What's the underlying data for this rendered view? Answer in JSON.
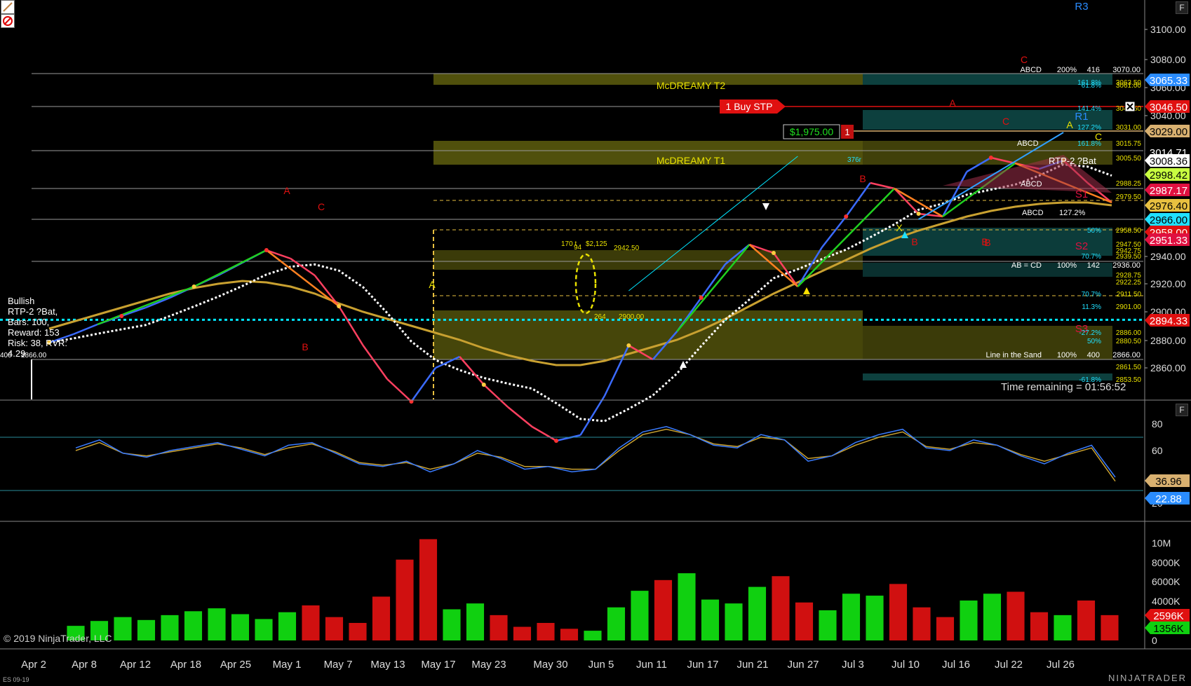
{
  "window": {
    "footer_left": "ES 09-19",
    "copyright": "© 2019 NinjaTrader, LLC",
    "brand": "NINJATRADER",
    "time_remaining": "Time remaining = 01:56:52",
    "panel_button": "F"
  },
  "colors": {
    "background": "#000000",
    "price_up": "#3b6bff",
    "price_down": "#ff4060",
    "sma_white": "#ffffff",
    "sma_gold": "#c8a030",
    "cyan_line": "#00e5ff",
    "volume_up": "#10d010",
    "volume_down": "#d01010",
    "zone_olive": "#6b6b10",
    "zone_teal": "#10504e"
  },
  "x_axis": {
    "labels": [
      "Apr 2",
      "Apr 8",
      "Apr 12",
      "Apr 18",
      "Apr 25",
      "May 1",
      "May 7",
      "May 13",
      "May 17",
      "May 23",
      "May 30",
      "Jun 5",
      "Jun 11",
      "Jun 17",
      "Jun 21",
      "Jun 27",
      "Jul 3",
      "Jul 10",
      "Jul 16",
      "Jul 22",
      "Jul 26"
    ]
  },
  "price_panel": {
    "y_ticks": [
      "3100.00",
      "3080.00",
      "3060.00",
      "3040.00",
      "2940.00",
      "2920.00",
      "2900.00",
      "2880.00",
      "2860.00"
    ],
    "tags": [
      {
        "value": "3065.33",
        "bg": "#2a8cff",
        "fg": "#ffffff"
      },
      {
        "value": "3046.50",
        "bg": "#e01010",
        "fg": "#ffffff"
      },
      {
        "value": "3029.00",
        "bg": "#d8b070",
        "fg": "#000000"
      },
      {
        "value": "3014.71",
        "bg": "#000000",
        "fg": "#ffffff"
      },
      {
        "value": "3008.36",
        "bg": "#ffffff",
        "fg": "#000000"
      },
      {
        "value": "2998.42",
        "bg": "#c8ff40",
        "fg": "#000000"
      },
      {
        "value": "2987.17",
        "bg": "#e01040",
        "fg": "#ffffff"
      },
      {
        "value": "2976.40",
        "bg": "#e8c040",
        "fg": "#000000"
      },
      {
        "value": "2966.00",
        "bg": "#20e0ff",
        "fg": "#000000"
      },
      {
        "value": "2958.00",
        "bg": "#e01010",
        "fg": "#ffffff"
      },
      {
        "value": "2951.33",
        "bg": "#e01040",
        "fg": "#ffffff"
      },
      {
        "value": "2894.33",
        "bg": "#e01010",
        "fg": "#ffffff"
      }
    ],
    "pivots": [
      "R3",
      "R1",
      "S1",
      "S2",
      "S3"
    ],
    "zone_labels": {
      "t2": "McDREAMY T2",
      "t1": "McDREAMY T1"
    },
    "order_label": "1 Buy STP",
    "pnl_label": "$1,975.00",
    "pnl_qty": "1",
    "pattern_box": [
      "Bullish",
      "RTP-2 ?Bat,",
      "Bars: 100,",
      "Reward: 153",
      "Risk: 38, RVR:",
      "4.29"
    ],
    "rtp_tag": "RTP-2 ?Bat",
    "abcd_rows": [
      {
        "a": "ABCD",
        "b": "200%",
        "c": "416",
        "d": "3070.00"
      },
      {
        "a": "AB = CD",
        "b": "100%",
        "c": "142",
        "d": "2936.00"
      },
      {
        "a": "Line in the Sand",
        "b": "100%",
        "c": "400",
        "d": "2866.00"
      }
    ],
    "abcd_small": [
      "ABCD",
      "ABCD",
      "ABCD",
      "127.2%"
    ],
    "fib_labels": [
      {
        "pct": "161.8%",
        "val": "3063.50"
      },
      {
        "pct": "61.8%",
        "val": "3061.00"
      },
      {
        "pct": "141.4%",
        "val": "3046.50"
      },
      {
        "pct": "127.2%",
        "val": "3031.00"
      },
      {
        "pct": "161.8%",
        "val": "3015.75"
      },
      {
        "pct": "50%",
        "val": "2958.50"
      },
      {
        "pct": "70.7%",
        "val": "2939.50"
      },
      {
        "pct": "70.7%",
        "val": "2911.50"
      },
      {
        "pct": "11.3%",
        "val": "2901.00"
      },
      {
        "pct": "-27.2%",
        "val": "2886.00"
      },
      {
        "pct": "50%",
        "val": "2880.50"
      },
      {
        "pct": "",
        "val": "2861.50"
      },
      {
        "pct": "-61.8%",
        "val": "2853.50"
      },
      {
        "pct": "",
        "val": "2947.50"
      },
      {
        "pct": "",
        "val": "2942.75"
      },
      {
        "pct": "",
        "val": "2928.75"
      },
      {
        "pct": "",
        "val": "2922.25"
      },
      {
        "pct": "",
        "val": "2979.50"
      },
      {
        "pct": "",
        "val": "2988.25"
      },
      {
        "pct": "",
        "val": "3005.50"
      }
    ],
    "misc_labels": [
      "170 t",
      "$2,125",
      "94",
      "2942.50",
      "264",
      "2900.00",
      "376r",
      "400",
      "2866.00"
    ],
    "point_labels": [
      "A",
      "B",
      "C",
      "A",
      "B",
      "C",
      "X",
      "A",
      "B",
      "C",
      "A",
      "B",
      "C",
      "B"
    ]
  },
  "rsi_panel": {
    "y_ticks": [
      "80",
      "60",
      "20"
    ],
    "tags": [
      {
        "value": "36.96",
        "bg": "#d8b070",
        "fg": "#000000"
      },
      {
        "value": "22.88",
        "bg": "#2a8cff",
        "fg": "#ffffff"
      }
    ]
  },
  "volume_panel": {
    "y_ticks": [
      "10M",
      "8000K",
      "6000K",
      "4000K",
      "2000K",
      "0"
    ],
    "tags": [
      {
        "value": "2596K",
        "bg": "#e01010",
        "fg": "#ffffff"
      },
      {
        "value": "1356K",
        "bg": "#10d010",
        "fg": "#000000"
      }
    ]
  },
  "chart_data": {
    "type": "line",
    "series": [
      {
        "values": [
          2878,
          2884,
          2891,
          2897,
          2903,
          2910,
          2918,
          2926,
          2935,
          2944,
          2938,
          2926,
          2904,
          2876,
          2852,
          2836,
          2860,
          2868,
          2848,
          2832,
          2818,
          2808,
          2812,
          2840,
          2876,
          2866,
          2886,
          2910,
          2934,
          2948,
          2942,
          2918,
          2946,
          2968,
          2992,
          2988,
          2970,
          2968,
          3000,
          3010,
          3006,
          3002,
          3008,
          2992,
          2978
        ]
      },
      {
        "values": [
          2888,
          2893,
          2898,
          2903,
          2908,
          2913,
          2917,
          2920,
          2922,
          2921,
          2918,
          2913,
          2906,
          2900,
          2895,
          2890,
          2885,
          2880,
          2874,
          2869,
          2865,
          2862,
          2862,
          2865,
          2870,
          2875,
          2880,
          2887,
          2895,
          2904,
          2913,
          2921,
          2929,
          2937,
          2945,
          2952,
          2958,
          2963,
          2968,
          2972,
          2975,
          2977,
          2978,
          2978,
          2976
        ]
      },
      {
        "values": [
          62,
          68,
          58,
          55,
          60,
          63,
          66,
          61,
          56,
          64,
          66,
          58,
          50,
          48,
          52,
          44,
          50,
          60,
          54,
          46,
          48,
          44,
          46,
          62,
          74,
          78,
          72,
          64,
          62,
          72,
          68,
          52,
          56,
          66,
          72,
          76,
          62,
          60,
          68,
          64,
          56,
          50,
          58,
          64,
          40
        ]
      },
      {
        "values": [
          60,
          66,
          58,
          56,
          59,
          62,
          65,
          62,
          57,
          62,
          65,
          59,
          51,
          49,
          51,
          46,
          50,
          58,
          55,
          48,
          48,
          46,
          46,
          60,
          72,
          76,
          72,
          65,
          63,
          70,
          68,
          54,
          56,
          64,
          70,
          74,
          63,
          61,
          66,
          64,
          57,
          52,
          57,
          62,
          37
        ]
      },
      {
        "values": [
          1.5,
          2.0,
          2.4,
          2.1,
          2.6,
          3.0,
          3.3,
          2.7,
          2.2,
          2.9,
          3.6,
          2.4,
          1.8,
          4.5,
          8.3,
          10.4,
          3.2,
          3.8,
          2.6,
          1.4,
          1.8,
          1.2,
          1.0,
          3.4,
          5.1,
          6.2,
          6.9,
          4.2,
          3.8,
          5.5,
          6.6,
          3.9,
          3.1,
          4.8,
          4.6,
          5.8,
          3.4,
          2.4,
          4.1,
          4.8,
          5.0,
          2.9,
          2.6,
          4.1,
          2.6
        ]
      }
    ],
    "ylim": [
      2840,
      3110
    ],
    "rsi_ylim": [
      10,
      90
    ],
    "volume_unit": "M",
    "volume_ylim": [
      0,
      11.5
    ]
  }
}
